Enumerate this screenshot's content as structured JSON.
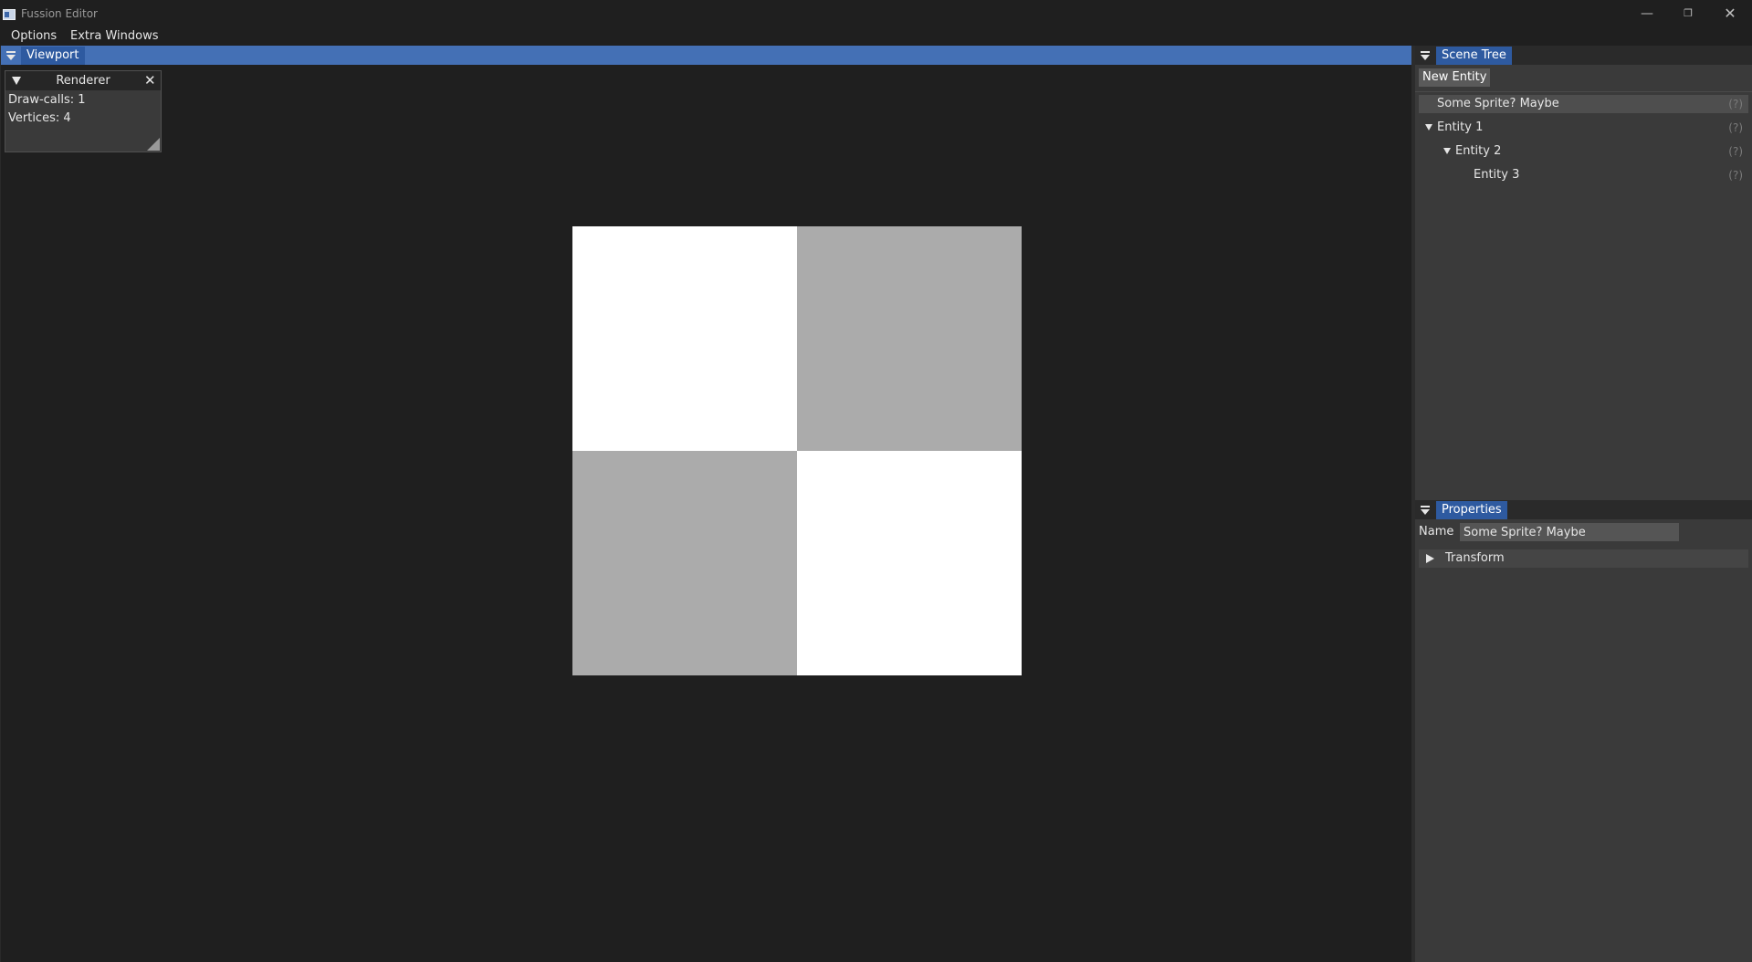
{
  "window": {
    "title": "Fussion Editor",
    "minimize_glyph": "—",
    "maximize_glyph": "❐",
    "close_glyph": "✕"
  },
  "menu": {
    "items": [
      "Options",
      "Extra Windows"
    ]
  },
  "viewport": {
    "tab_label": "Viewport",
    "renderer": {
      "title": "Renderer",
      "draw_calls": "Draw-calls: 1",
      "vertices": "Vertices: 4"
    },
    "sprite_colors": [
      "#ffffff",
      "#ababab",
      "#ababab",
      "#ffffff"
    ]
  },
  "scene_tree": {
    "tab_label": "Scene Tree",
    "new_entity_label": "New Entity",
    "help_marker": "(?)",
    "items": [
      {
        "label": "Some Sprite? Maybe",
        "selected": true
      },
      {
        "label": "Entity 1",
        "expanded": true
      },
      {
        "label": "Entity 2",
        "expanded": true
      },
      {
        "label": "Entity 3"
      }
    ]
  },
  "properties": {
    "tab_label": "Properties",
    "name_label": "Name",
    "name_value": "Some Sprite? Maybe",
    "transform_label": "Transform"
  },
  "colors": {
    "accent": "#4470b5",
    "tab_active": "#2e5aa0",
    "background": "#1f1f1f",
    "panel": "#3a3a3a"
  }
}
